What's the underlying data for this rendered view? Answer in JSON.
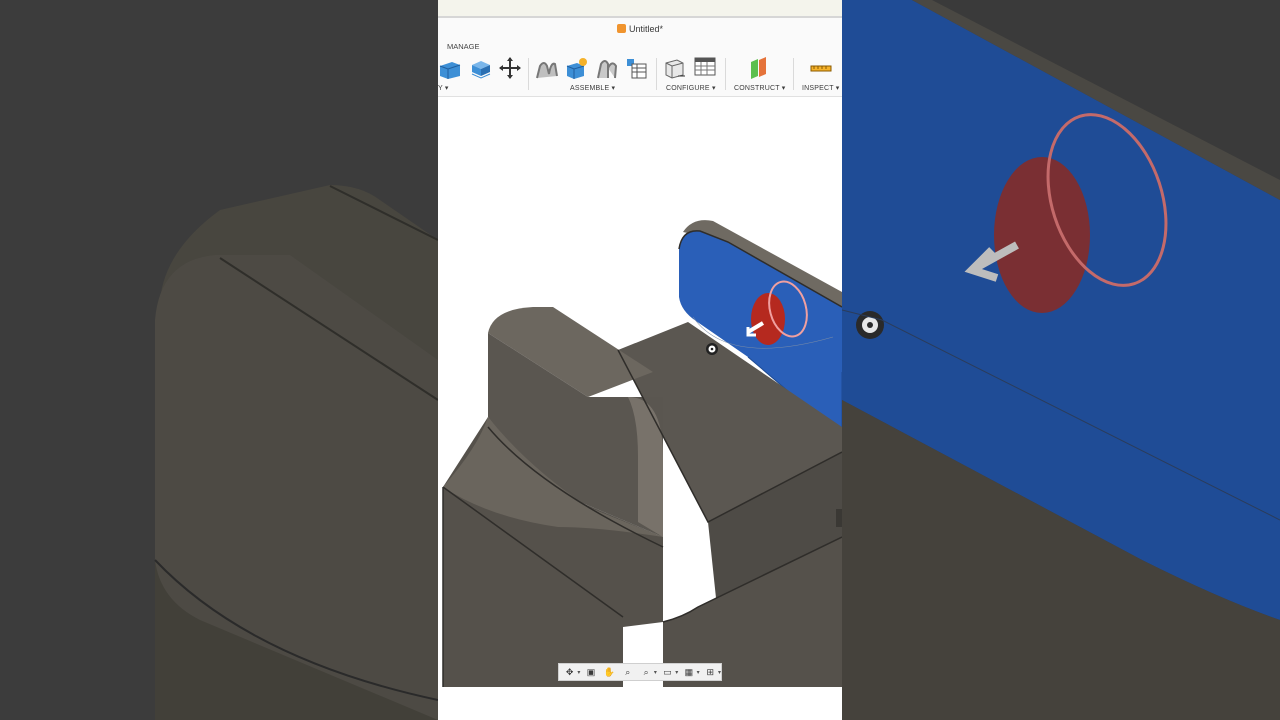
{
  "document": {
    "title": "Untitled*"
  },
  "ribbon": {
    "manage_label": "MANAGE",
    "groups": {
      "prev_fragment": "Y ▾",
      "assemble": "ASSEMBLE ▾",
      "configure": "CONFIGURE ▾",
      "construct": "CONSTRUCT ▾",
      "inspect": "INSPECT ▾"
    }
  },
  "icons": {
    "create": [
      "box-icon",
      "extrude-icon",
      "move-icon"
    ],
    "assemble": [
      "joint-icon",
      "new-component-icon",
      "rigid-group-icon",
      "table-icon"
    ],
    "configure": [
      "configure-shape-icon",
      "configure-table-icon"
    ],
    "construct": [
      "offset-plane-icon"
    ],
    "inspect": [
      "measure-icon"
    ]
  },
  "navigation_bar": {
    "tools": [
      "orbit-icon",
      "look-at-icon",
      "pan-icon",
      "zoom-icon",
      "zoom-window-icon",
      "display-settings-icon",
      "grid-icon",
      "viewports-icon"
    ]
  },
  "colors": {
    "selected_face": "#2a5fb8",
    "body": "#5a5650",
    "body_light": "#6c675f",
    "hole_red": "#b5291f",
    "accent_orange": "#f0942e"
  }
}
